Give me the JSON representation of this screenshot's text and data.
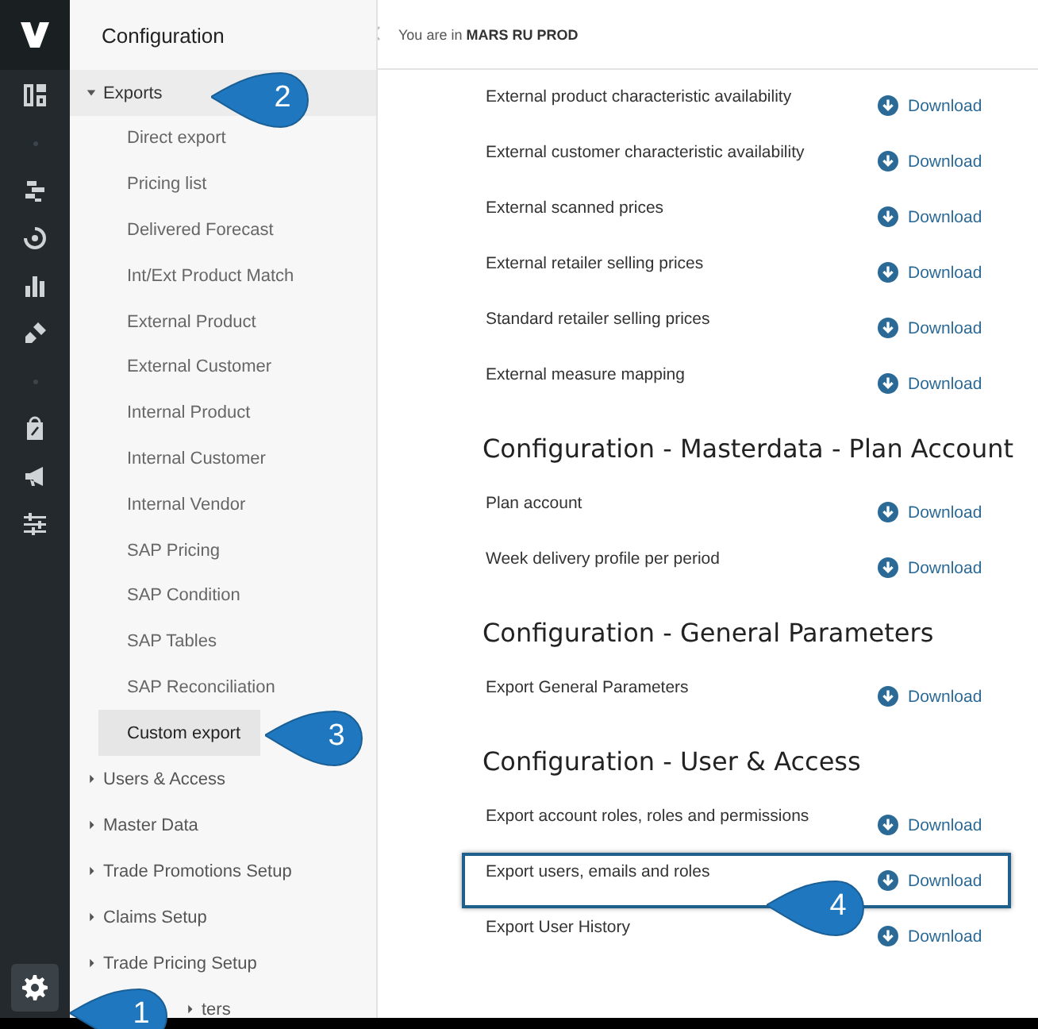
{
  "rail": {
    "settings_selected": true
  },
  "sidebar": {
    "title": "Configuration",
    "items": [
      {
        "label": "Exports",
        "expanded": true,
        "children": [
          {
            "label": "Direct export",
            "selected": false
          },
          {
            "label": "Pricing list",
            "selected": false
          },
          {
            "label": "Delivered Forecast",
            "selected": false
          },
          {
            "label": "Int/Ext Product Match",
            "selected": false
          },
          {
            "label": "External Product",
            "selected": false
          },
          {
            "label": "External Customer",
            "selected": false
          },
          {
            "label": "Internal Product",
            "selected": false
          },
          {
            "label": "Internal Customer",
            "selected": false
          },
          {
            "label": "Internal Vendor",
            "selected": false
          },
          {
            "label": "SAP Pricing",
            "selected": false
          },
          {
            "label": "SAP Condition",
            "selected": false
          },
          {
            "label": "SAP Tables",
            "selected": false
          },
          {
            "label": "SAP Reconciliation",
            "selected": false
          },
          {
            "label": "Custom export",
            "selected": true
          }
        ]
      },
      {
        "label": "Users & Access",
        "expanded": false
      },
      {
        "label": "Master Data",
        "expanded": false
      },
      {
        "label": "Trade Promotions Setup",
        "expanded": false
      },
      {
        "label": "Claims Setup",
        "expanded": false
      },
      {
        "label": "Trade Pricing Setup",
        "expanded": false
      },
      {
        "label": "ters",
        "expanded": false
      }
    ]
  },
  "top_bar": {
    "location": "You are in **MARS RU PROD**"
  },
  "sections": [
    {
      "rows": [
        {
          "label": "External product characteristic availability",
          "action": "Download",
          "highlighted": false
        },
        {
          "label": "External customer characteristic availability",
          "action": "Download",
          "highlighted": false
        },
        {
          "label": "External scanned prices",
          "action": "Download",
          "highlighted": false
        },
        {
          "label": "External retailer selling prices",
          "action": "Download",
          "highlighted": false
        },
        {
          "label": "Standard retailer selling prices",
          "action": "Download",
          "highlighted": false
        },
        {
          "label": "External measure mapping",
          "action": "Download",
          "highlighted": false
        }
      ]
    },
    {
      "heading": "Configuration - Masterdata - Plan Account",
      "rows": [
        {
          "label": "Plan account",
          "action": "Download",
          "highlighted": false
        },
        {
          "label": "Week delivery profile per period",
          "action": "Download",
          "highlighted": false
        }
      ]
    },
    {
      "heading": "Configuration - General Parameters",
      "rows": [
        {
          "label": "Export General Parameters",
          "action": "Download",
          "highlighted": false
        }
      ]
    },
    {
      "heading": "Configuration - User & Access",
      "rows": [
        {
          "label": "Export account roles, roles and permissions",
          "action": "Download",
          "highlighted": false
        },
        {
          "label": "Export users, emails and roles",
          "action": "Download",
          "highlighted": true
        },
        {
          "label": "Export User History",
          "action": "Download",
          "highlighted": false
        }
      ]
    }
  ],
  "callouts": [
    {
      "number": "1"
    },
    {
      "number": "2"
    },
    {
      "number": "3"
    },
    {
      "number": "4"
    }
  ]
}
